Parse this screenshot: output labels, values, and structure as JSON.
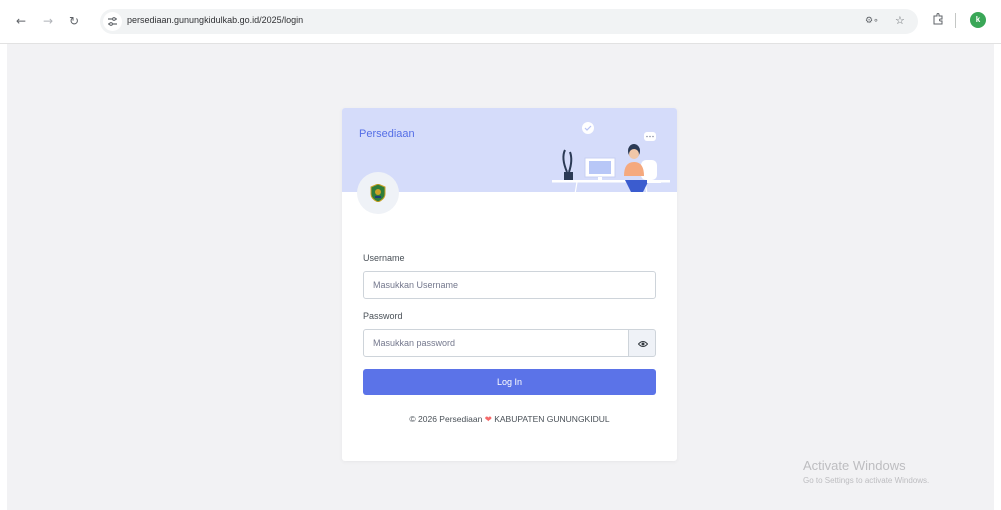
{
  "browser": {
    "url": "persediaan.gunungkidulkab.go.id/2025/login",
    "profile_initial": "k"
  },
  "brand": {
    "title": "Persediaan"
  },
  "form": {
    "username_label": "Username",
    "username_placeholder": "Masukkan Username",
    "username_value": "",
    "password_label": "Password",
    "password_placeholder": "Masukkan password",
    "password_value": "",
    "login_button": "Log In"
  },
  "footer": {
    "copyright": "© 2026 Persediaan",
    "org": "KABUPATEN GUNUNGKIDUL"
  },
  "watermark": {
    "title": "Activate Windows",
    "subtitle": "Go to Settings to activate Windows."
  },
  "colors": {
    "primary": "#556ee6",
    "header_bg": "#d5dcfa",
    "heart": "#f46a6a"
  }
}
